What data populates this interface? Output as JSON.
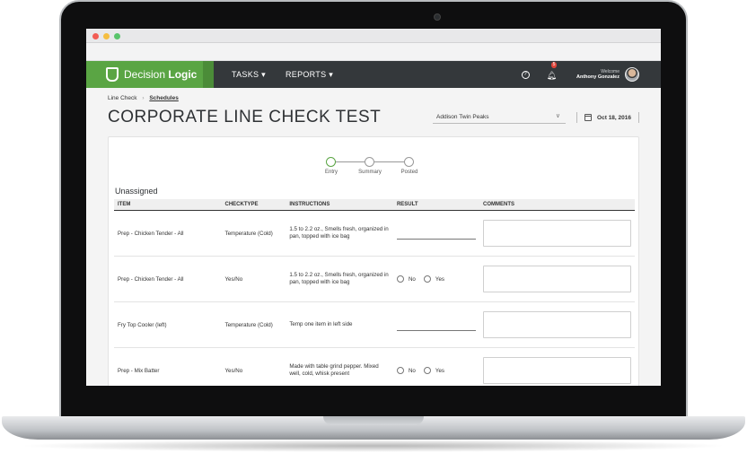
{
  "app": {
    "brand_light": "Decision ",
    "brand_bold": "Logic",
    "accent_color": "#5aa544",
    "nav_color": "#34383b"
  },
  "nav": {
    "tasks_label": "TASKS ▾",
    "reports_label": "REPORTS ▾",
    "help_icon": "?",
    "notification_count": "5",
    "welcome_label": "Welcome",
    "user_name": "Anthony Gonzalez"
  },
  "breadcrumb": {
    "root": "Line Check",
    "current": "Schedules"
  },
  "page": {
    "title": "CORPORATE LINE CHECK TEST",
    "location": "Addison Twin Peaks",
    "date": "Oct 18, 2016"
  },
  "stepper": {
    "steps": [
      "Entry",
      "Summary",
      "Posted"
    ],
    "active_step": "Entry"
  },
  "section": {
    "title": "Unassigned"
  },
  "table": {
    "headers": [
      "ITEM",
      "CHECKTYPE",
      "INSTRUCTIONS",
      "RESULT",
      "COMMENTS"
    ],
    "radio_no": "No",
    "radio_yes": "Yes",
    "rows": [
      {
        "item": "Prep - Chicken Tender - All",
        "checktype": "Temperature (Cold)",
        "instructions": "1.5 to 2.2 oz., Smells fresh, organized in pan, topped with ice bag",
        "result_type": "text"
      },
      {
        "item": "Prep - Chicken Tender - All",
        "checktype": "Yes/No",
        "instructions": "1.5 to 2.2 oz., Smells fresh, organized in pan, topped with ice bag",
        "result_type": "radio"
      },
      {
        "item": "Fry Top Cooler (left)",
        "checktype": "Temperature (Cold)",
        "instructions": "Temp one item in left side",
        "result_type": "text"
      },
      {
        "item": "Prep - Mix Batter",
        "checktype": "Yes/No",
        "instructions": "Made with table grind pepper. Mixed well, cold, whisk present",
        "result_type": "radio"
      }
    ]
  }
}
